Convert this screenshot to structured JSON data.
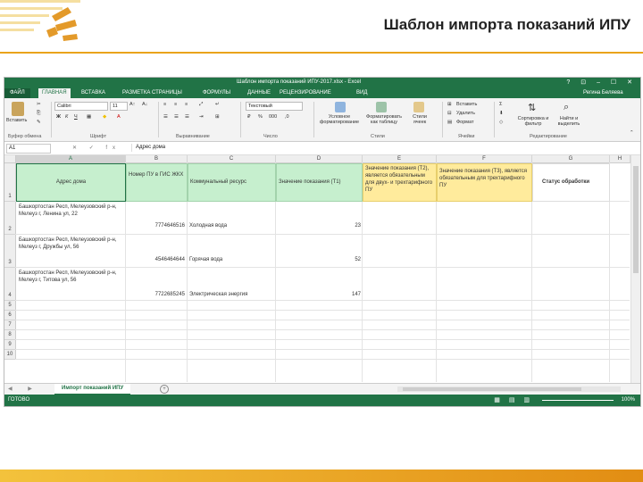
{
  "slide": {
    "title": "Шаблон импорта показаний ИПУ",
    "accent": "#e9a31b"
  },
  "excel": {
    "window_title": "Шаблон импорта показаний ИПУ-2017.xlsx - Excel",
    "window_buttons": "? ⊡ – ☐ ✕",
    "tabs": [
      "ФАЙЛ",
      "ГЛАВНАЯ",
      "ВСТАВКА",
      "РАЗМЕТКА СТРАНИЦЫ",
      "ФОРМУЛЫ",
      "ДАННЫЕ",
      "РЕЦЕНЗИРОВАНИЕ",
      "ВИД"
    ],
    "user": "Регина Беляева",
    "ribbon": {
      "paste": "Вставить",
      "clipboard_label": "Буфер обмена",
      "font_name": "Calibri",
      "font_size": "11",
      "font_label": "Шрифт",
      "alignment_label": "Выравнивание",
      "number_format": "Текстовый",
      "number_label": "Число",
      "cond_format": "Условное форматирование",
      "format_as_table": "Форматировать как таблицу",
      "cell_styles": "Стили ячеек",
      "styles_label": "Стили",
      "insert": "Вставить",
      "delete": "Удалить",
      "format": "Формат",
      "cells_label": "Ячейки",
      "sort_filter": "Сортировка и фильтр",
      "find_select": "Найти и выделить",
      "editing_label": "Редактирование"
    },
    "namebox": "A1",
    "fx_icons": "✕ ✓ fx",
    "formula": "Адрес дома",
    "columns": [
      "A",
      "B",
      "C",
      "D",
      "E",
      "F",
      "G",
      "H"
    ],
    "rows": [
      "1",
      "2",
      "3",
      "4",
      "5",
      "6",
      "7",
      "8",
      "9",
      "10"
    ],
    "headers": {
      "a": "Адрес дома",
      "b": "Номер ПУ в ГИС ЖКХ",
      "c": "Коммунальный ресурс",
      "d": "Значение показания (Т1)",
      "e": "Значение показания (Т2), является обязательным для двух- и трехтарифного ПУ",
      "f": "Значение показания (Т3), является обязательным для трехтарифного ПУ",
      "g": "Статус обработки"
    },
    "data_rows": [
      {
        "address": "Башкортостан Респ, Мелеузовский р-н, Мелеуз г, Ленина ул, 22",
        "meter": "7774646516",
        "resource": "Холодная вода",
        "value": "23"
      },
      {
        "address": "Башкортостан Респ, Мелеузовский р-н, Мелеуз г, Дружбы ул, 56",
        "meter": "4546464644",
        "resource": "Горячая вода",
        "value": "52"
      },
      {
        "address": "Башкортостан Респ, Мелеузовский р-н, Мелеуз г, Титова ул, 56",
        "meter": "7722685245",
        "resource": "Электрическая энергия",
        "value": "147"
      }
    ],
    "sheet_tab": "Импорт показаний ИПУ",
    "sheet_nav": "◀ ▶",
    "add_sheet": "+",
    "status": "ГОТОВО",
    "view_icons": "▦ ▤ ▥",
    "zoom": "100%"
  }
}
